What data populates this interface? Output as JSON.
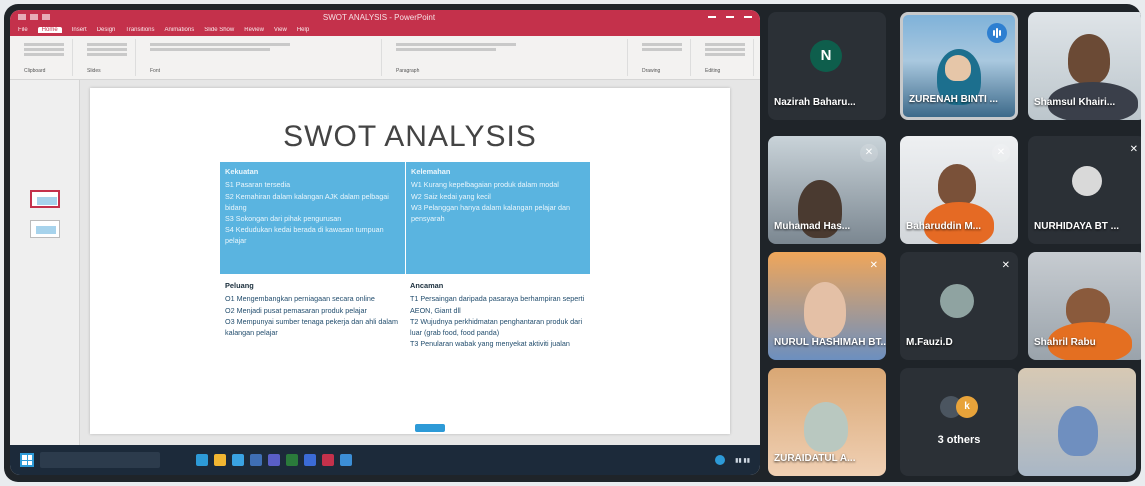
{
  "app": {
    "window_title": "SWOT ANALYSIS - PowerPoint",
    "ribbon_tabs": [
      "File",
      "Home",
      "Insert",
      "Design",
      "Transitions",
      "Animations",
      "Slide Show",
      "Review",
      "View",
      "Help"
    ],
    "ribbon_groups": [
      "Clipboard",
      "Slides",
      "Font",
      "Paragraph",
      "Drawing",
      "Editing"
    ]
  },
  "slide": {
    "title": "SWOT ANALYSIS",
    "strengths": {
      "heading": "Kekuatan",
      "items": [
        "S1 Pasaran tersedia",
        "S2 Kemahiran dalam kalangan AJK dalam pelbagai bidang",
        "S3 Sokongan dari pihak pengurusan",
        "S4 Kedudukan kedai berada di kawasan tumpuan pelajar"
      ]
    },
    "weaknesses": {
      "heading": "Kelemahan",
      "items": [
        "W1 Kurang kepelbagaian produk dalam modal",
        "W2 Saiz kedai yang kecil",
        "W3 Pelanggan hanya dalam kalangan pelajar dan pensyarah"
      ]
    },
    "opportunities": {
      "heading": "Peluang",
      "items": [
        "O1 Mengembangkan perniagaan secara online",
        "O2 Menjadi pusat pemasaran produk pelajar",
        "O3 Mempunyai sumber tenaga pekerja dan ahli dalam kalangan pelajar"
      ]
    },
    "threats": {
      "heading": "Ancaman",
      "items": [
        "T1 Persaingan daripada pasaraya berhampiran seperti AEON, Giant dll",
        "T2 Wujudnya perkhidmatan penghantaran produk dari luar (grab food, food panda)",
        "T3 Penularan wabak yang menyekat aktiviti jualan"
      ]
    }
  },
  "participants": [
    {
      "name": "Nazirah Baharu...",
      "initial": "N"
    },
    {
      "name": "ZURENAH BINTI ..."
    },
    {
      "name": "Shamsul Khairi..."
    },
    {
      "name": "Muhamad Has..."
    },
    {
      "name": "Baharuddin M..."
    },
    {
      "name": "NURHIDAYA BT ..."
    },
    {
      "name": "NURUL HASHIMAH BT..."
    },
    {
      "name": "M.Fauzi.D"
    },
    {
      "name": "Shahril Rabu"
    },
    {
      "name": "ZURAIDATUL A..."
    },
    {
      "name": "3 others",
      "badge": "k"
    },
    {
      "name": ""
    }
  ],
  "colors": {
    "ppt_red": "#c4314b",
    "swot_blue": "#5ab4e0",
    "teams_bg": "#1f2429",
    "avatar_green": "#0e5e4c",
    "speaking_blue": "#2d7fd1",
    "others_badge": "#e8a33a"
  },
  "icons": [
    "mic-off-icon",
    "speaking-icon",
    "windows-start-icon"
  ]
}
